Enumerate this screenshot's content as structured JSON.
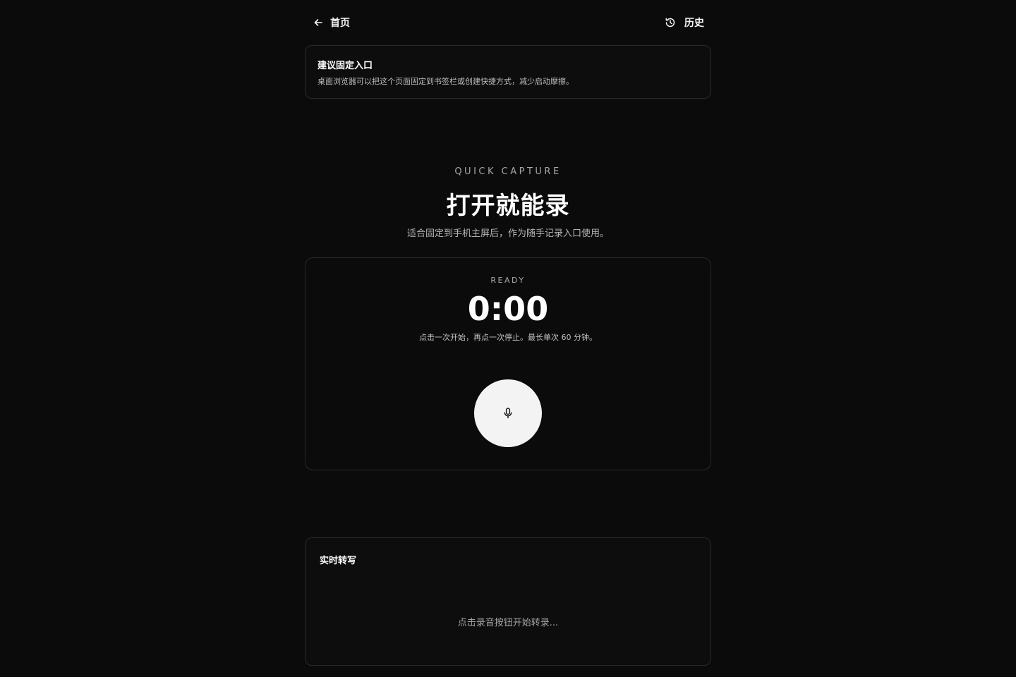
{
  "header": {
    "back_label": "首页",
    "history_label": "历史",
    "back_icon": "arrow-left-icon",
    "history_icon": "history-icon"
  },
  "pin_card": {
    "title": "建议固定入口",
    "description": "桌面浏览器可以把这个页面固定到书签栏或创建快捷方式，减少启动摩擦。"
  },
  "hero": {
    "eyebrow": "QUICK CAPTURE",
    "title": "打开就能录",
    "subtitle": "适合固定到手机主屏后，作为随手记录入口使用。"
  },
  "recorder": {
    "status": "READY",
    "timer": "0:00",
    "hint": "点击一次开始，再点一次停止。最长单次 60 分钟。",
    "button_icon": "microphone-icon"
  },
  "transcript": {
    "title": "实时转写",
    "empty_text": "点击录音按钮开始转录..."
  },
  "colors": {
    "background": "#0b0b0b",
    "card_border": "#2a2a2a",
    "record_button": "#f3f3f3",
    "text_primary": "#ffffff",
    "text_muted": "#a6a6a6"
  }
}
